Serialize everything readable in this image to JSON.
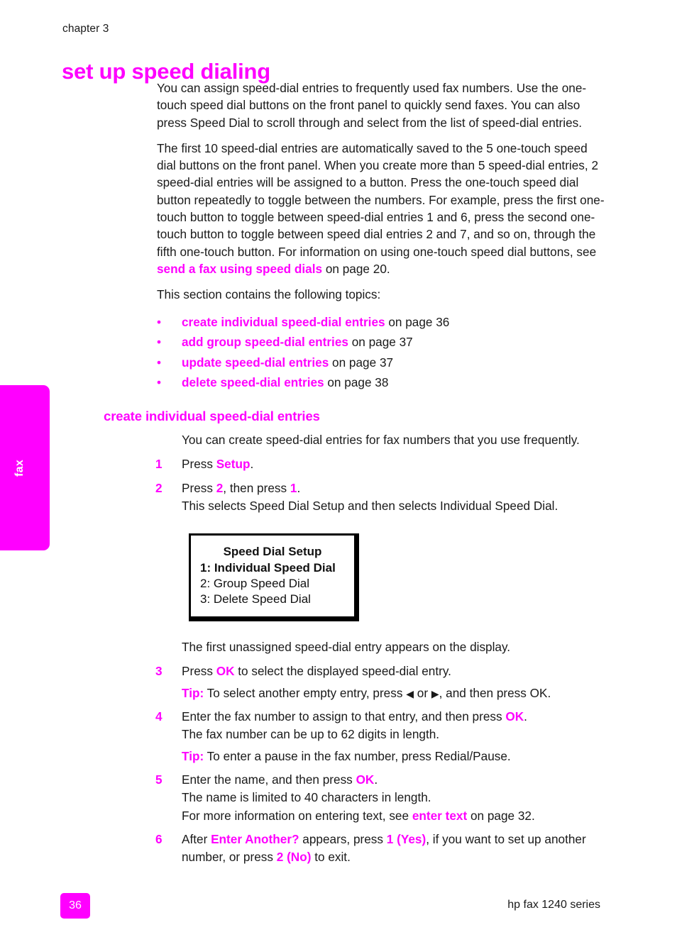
{
  "document": {
    "chapter_label": "chapter 3",
    "title": "set up speed dialing"
  },
  "side_tab": {
    "label": "fax",
    "color": "#FF00FF"
  },
  "intro": {
    "paragraph_1_part_1": "You can assign speed-dial entries to frequently used fax numbers. Use the one-touch speed dial buttons on the front panel to quickly send faxes. You can also press Speed Dial to scroll through and select from the list of speed-dial entries.",
    "paragraph_2_part_1": "The first 10 speed-dial entries are automatically saved to the 5 one-touch speed dial buttons on the front panel. When you create more than 5 speed-dial entries, 2 speed-dial entries will be assigned to a button. Press the one-touch speed dial button repeatedly to toggle between the numbers. For example, press the first one-touch button to toggle between speed-dial entries 1 and 6, press the second one-touch button to toggle between speed dial entries 2 and 7, and so on, through the fifth one-touch button. For information on using one-touch speed dial buttons, see ",
    "paragraph_2_link": "send a fax using speed dials",
    "paragraph_2_part_2": " on page 20.",
    "topics_intro": "This section contains the following topics:"
  },
  "topics": [
    {
      "bullet": "•",
      "link": "create individual speed-dial entries",
      "tail": " on page 36"
    },
    {
      "bullet": "•",
      "link": "add group speed-dial entries",
      "tail": " on page 37"
    },
    {
      "bullet": "•",
      "link": "update speed-dial entries",
      "tail": " on page 37"
    },
    {
      "bullet": "•",
      "link": "delete speed-dial entries",
      "tail": " on page 38"
    }
  ],
  "section": {
    "heading": "create individual speed-dial entries",
    "lead": "You can create speed-dial entries for fax numbers that you use frequently."
  },
  "steps": {
    "step1": {
      "num": "1",
      "text_before": "Press ",
      "key": "Setup",
      "text_after": "."
    },
    "step2": {
      "num": "2",
      "text_before": "Press ",
      "key_a": "2",
      "text_mid": ", then press ",
      "key_b": "1",
      "text_after": ".",
      "detail": "This selects Speed Dial Setup and then selects Individual Speed Dial."
    },
    "after_display": "The first unassigned speed-dial entry appears on the display.",
    "step3": {
      "num": "3",
      "text_before": "Press ",
      "key": "OK",
      "text_after": " to select the displayed speed-dial entry.",
      "tip_label": "Tip:",
      "tip_before": " To select another empty entry, press ",
      "arrow_left": "◀",
      "tip_mid": " or ",
      "arrow_right": "▶",
      "tip_after": ", and then press OK."
    },
    "step4": {
      "num": "4",
      "text_before": "Enter the fax number to assign to that entry, and then press ",
      "key": "OK",
      "text_after": ".",
      "detail": "The fax number can be up to 62 digits in length.",
      "tip_label": "Tip:",
      "tip_text": " To enter a pause in the fax number, press Redial/Pause."
    },
    "step5": {
      "num": "5",
      "text_before": "Enter the name, and then press ",
      "key": "OK",
      "text_after": ".",
      "detail": "The name is limited to 40 characters in length.",
      "detail2_before": "For more information on entering text, see ",
      "detail2_link": "enter text",
      "detail2_after": " on page 32."
    },
    "step6": {
      "num": "6",
      "text_before": "After ",
      "key_prompt": "Enter Another?",
      "text_mid": " appears, press ",
      "key_yes": "1 (Yes)",
      "text_mid2": ", if you want to set up another number, or press ",
      "key_no": "2 (No)",
      "text_after": " to exit."
    }
  },
  "lcd_display": {
    "title": "Speed Dial Setup",
    "lines": [
      "1: Individual Speed Dial",
      "2: Group Speed Dial",
      "3: Delete Speed Dial"
    ]
  },
  "footer": {
    "page_number": "36",
    "product": "hp fax 1240 series"
  }
}
